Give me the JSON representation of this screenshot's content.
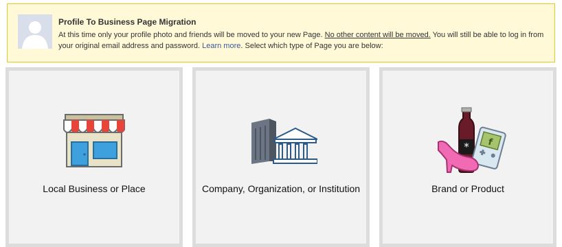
{
  "notice": {
    "title": "Profile To Business Page Migration",
    "text_before": "At this time only your profile photo and friends will be moved to your new Page. ",
    "text_underlined": "No other content will be moved.",
    "text_middle": " You will still be able to log in from your original email address and password. ",
    "link": "Learn more",
    "text_after": ". Select which type of Page you are below:"
  },
  "options": [
    {
      "label": "Local Business or Place",
      "icon": "storefront-icon"
    },
    {
      "label": "Company, Organization, or Institution",
      "icon": "office-building-icon"
    },
    {
      "label": "Brand or Product",
      "icon": "brand-products-icon"
    }
  ],
  "colors": {
    "notice_bg": "#fff9d7",
    "notice_border": "#e2c822",
    "link": "#3b5998",
    "card_bg": "#f2f2f2",
    "card_border": "#dcdcdc"
  }
}
